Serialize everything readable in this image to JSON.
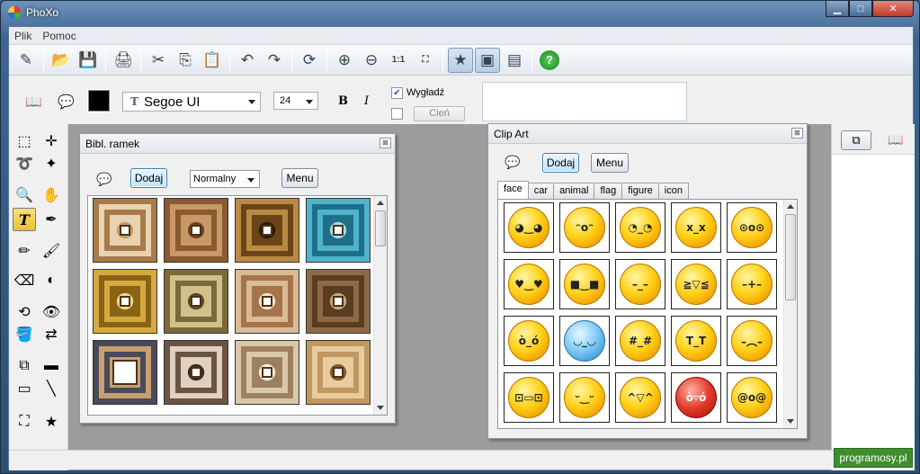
{
  "window": {
    "title": "PhoXo",
    "min": "▁",
    "max": "□",
    "close": "✕"
  },
  "menu": [
    "Plik",
    "Pomoc"
  ],
  "toolbar": {
    "icons": [
      "new-icon",
      "open-icon",
      "save-icon",
      "print-icon",
      "cut-icon",
      "copy-icon",
      "paste-icon",
      "undo-icon",
      "redo-icon",
      "refresh-icon",
      "zoom-in-icon",
      "zoom-out-icon",
      "actual-size-icon",
      "fit-window-icon",
      "star-icon",
      "frame-icon",
      "layers-icon",
      "help-icon"
    ],
    "glyphs": [
      "✎",
      "📂",
      "💾",
      "🖨",
      "✂",
      "⎘",
      "📋",
      "↶",
      "↷",
      "⟳",
      "⊕",
      "⊖",
      "1:1",
      "⛶",
      "★",
      "▣",
      "▤",
      "?"
    ]
  },
  "props": {
    "font": "Segoe UI",
    "size": "24",
    "bold": "B",
    "italic": "I",
    "smooth_label": "Wygładź",
    "smooth_checked": true,
    "shadow_label": "Cień",
    "color": "#000000"
  },
  "left_tools": [
    "select-rect-icon",
    "move-icon",
    "lasso-icon",
    "magic-wand-icon",
    "zoom-icon",
    "hand-icon",
    "text-icon",
    "eyedropper-icon",
    "pencil-icon",
    "brush-icon",
    "eraser-icon",
    "contrast-icon",
    "clone-icon",
    "eye-icon",
    "bucket-icon",
    "color-replace-icon",
    "stamp-icon",
    "gradient-icon",
    "gradient-fill-icon",
    "line-icon",
    "crop-icon",
    "star-shape-icon"
  ],
  "left_glyphs": [
    "⬚",
    "✛",
    "➰",
    "✦",
    "🔍",
    "✋",
    "T",
    "✒",
    "✏",
    "🖌",
    "⌫",
    "◐",
    "⟲",
    "👁",
    "🪣",
    "⇄",
    "⧉",
    "▬",
    "▭",
    "╲",
    "⛶",
    "★"
  ],
  "frames_panel": {
    "title": "Bibl. ramek",
    "add_button": "Dodaj",
    "mode": "Normalny",
    "menu_button": "Menu",
    "frames": [
      {
        "outer": "#a87a4a",
        "mid": "#e8d2b0",
        "inner": "#c49a64"
      },
      {
        "outer": "#8a5a30",
        "mid": "#c89868",
        "inner": "#6e4420"
      },
      {
        "outer": "#b98a44",
        "mid": "#6b4418",
        "inner": "#2b1a08"
      },
      {
        "outer": "#4fb3c9",
        "mid": "#1f6f8a",
        "inner": "#a9d7e3"
      },
      {
        "outer": "#d4a944",
        "mid": "#8a6414",
        "inner": "#f3d780"
      },
      {
        "outer": "#7a6a3a",
        "mid": "#d2c08a",
        "inner": "#5c4c20"
      },
      {
        "outer": "#d9bb94",
        "mid": "#a5744a",
        "inner": "#f0e2c8"
      },
      {
        "outer": "#8c6a48",
        "mid": "#5a3c20",
        "inner": "#c9a478"
      },
      {
        "outer": "#4a4a5a",
        "mid": "#c8a070",
        "inner": "#fff6e0"
      },
      {
        "outer": "#6b5446",
        "mid": "#e0d0c0",
        "inner": "#3c2a20"
      },
      {
        "outer": "#d8c7a8",
        "mid": "#9c8060",
        "inner": "#f4ecd8"
      },
      {
        "outer": "#c09860",
        "mid": "#e8cca0",
        "inner": "#8a5a2a"
      }
    ]
  },
  "clipart_panel": {
    "title": "Clip Art",
    "add_button": "Dodaj",
    "menu_button": "Menu",
    "tabs": [
      "face",
      "car",
      "animal",
      "flag",
      "figure",
      "icon"
    ],
    "selected_tab": "face",
    "emoticons": [
      {
        "name": "blushing-face-icon",
        "face": "◕‿◕",
        "style": "yellow"
      },
      {
        "name": "surprised-face-icon",
        "face": "ᵔoᵔ",
        "style": "yellow"
      },
      {
        "name": "tired-face-icon",
        "face": "◔_◔",
        "style": "yellow"
      },
      {
        "name": "bandaged-face-icon",
        "face": "x_x",
        "style": "yellow"
      },
      {
        "name": "shocked-face-icon",
        "face": "⊙o⊙",
        "style": "yellow"
      },
      {
        "name": "love-face-icon",
        "face": "♥‿♥",
        "style": "yellow"
      },
      {
        "name": "sunglasses-face-icon",
        "face": "■‿■",
        "style": "yellow"
      },
      {
        "name": "sleepy-face-icon",
        "face": "–_–",
        "style": "yellow"
      },
      {
        "name": "grinning-face-icon",
        "face": "≧▽≦",
        "style": "yellow"
      },
      {
        "name": "confused-face-icon",
        "face": "–+–",
        "style": "yellow"
      },
      {
        "name": "angry-face-icon",
        "face": "ò_ó",
        "style": "yellow"
      },
      {
        "name": "cold-face-icon",
        "face": "◡_◡",
        "style": "blue"
      },
      {
        "name": "scribble-face-icon",
        "face": "#_#",
        "style": "yellow"
      },
      {
        "name": "crying-face-icon",
        "face": "T_T",
        "style": "yellow"
      },
      {
        "name": "sad-face-icon",
        "face": "–︵–",
        "style": "yellow"
      },
      {
        "name": "teeth-face-icon",
        "face": "⊡▭⊡",
        "style": "yellow"
      },
      {
        "name": "drooling-face-icon",
        "face": "ᵕ‿ᵕ",
        "style": "yellow"
      },
      {
        "name": "laughing-face-icon",
        "face": "^▽^",
        "style": "yellow"
      },
      {
        "name": "devil-face-icon",
        "face": "ò▿ó",
        "style": "red"
      },
      {
        "name": "injured-face-icon",
        "face": "@o@",
        "style": "yellow"
      }
    ]
  },
  "right_panel": {
    "icons": [
      "layers-panel-icon",
      "book-panel-icon"
    ],
    "glyphs": [
      "⧉",
      "📖"
    ]
  },
  "watermark": "programosy.pl"
}
